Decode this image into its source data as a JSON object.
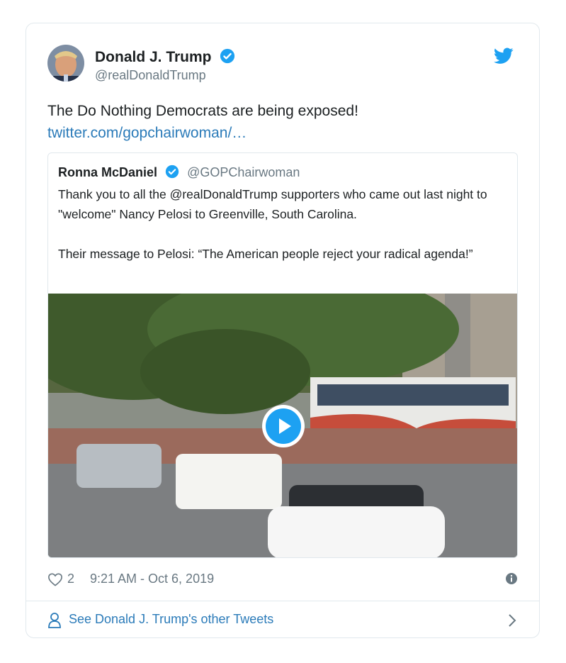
{
  "tweet": {
    "author_name": "Donald J. Trump",
    "author_handle": "@realDonaldTrump",
    "text": "The Do Nothing Democrats are being exposed!",
    "link_text": "twitter.com/gopchairwoman/…",
    "likes": "2",
    "timestamp": "9:21 AM - Oct 6, 2019"
  },
  "quote": {
    "author_name": "Ronna McDaniel",
    "author_handle": "@GOPChairwoman",
    "paragraph1": "Thank you to all the @realDonaldTrump supporters who came out last night to \"welcome\" Nancy Pelosi to Greenville, South Carolina.",
    "paragraph2": "Their message to Pelosi: “The American people reject your radical agenda!”"
  },
  "footer": {
    "see_more_label": "See Donald J. Trump's other Tweets"
  },
  "icons": {
    "brand": "twitter-bird-icon",
    "verified": "verified-badge-icon",
    "like": "heart-icon",
    "info": "info-icon",
    "profile": "person-icon",
    "chevron": "chevron-right-icon",
    "play": "play-icon"
  },
  "colors": {
    "accent": "#1da1f2",
    "link": "#2b7bb9",
    "text": "#1c2022",
    "muted": "#697882",
    "border": "#e1e8ed"
  }
}
